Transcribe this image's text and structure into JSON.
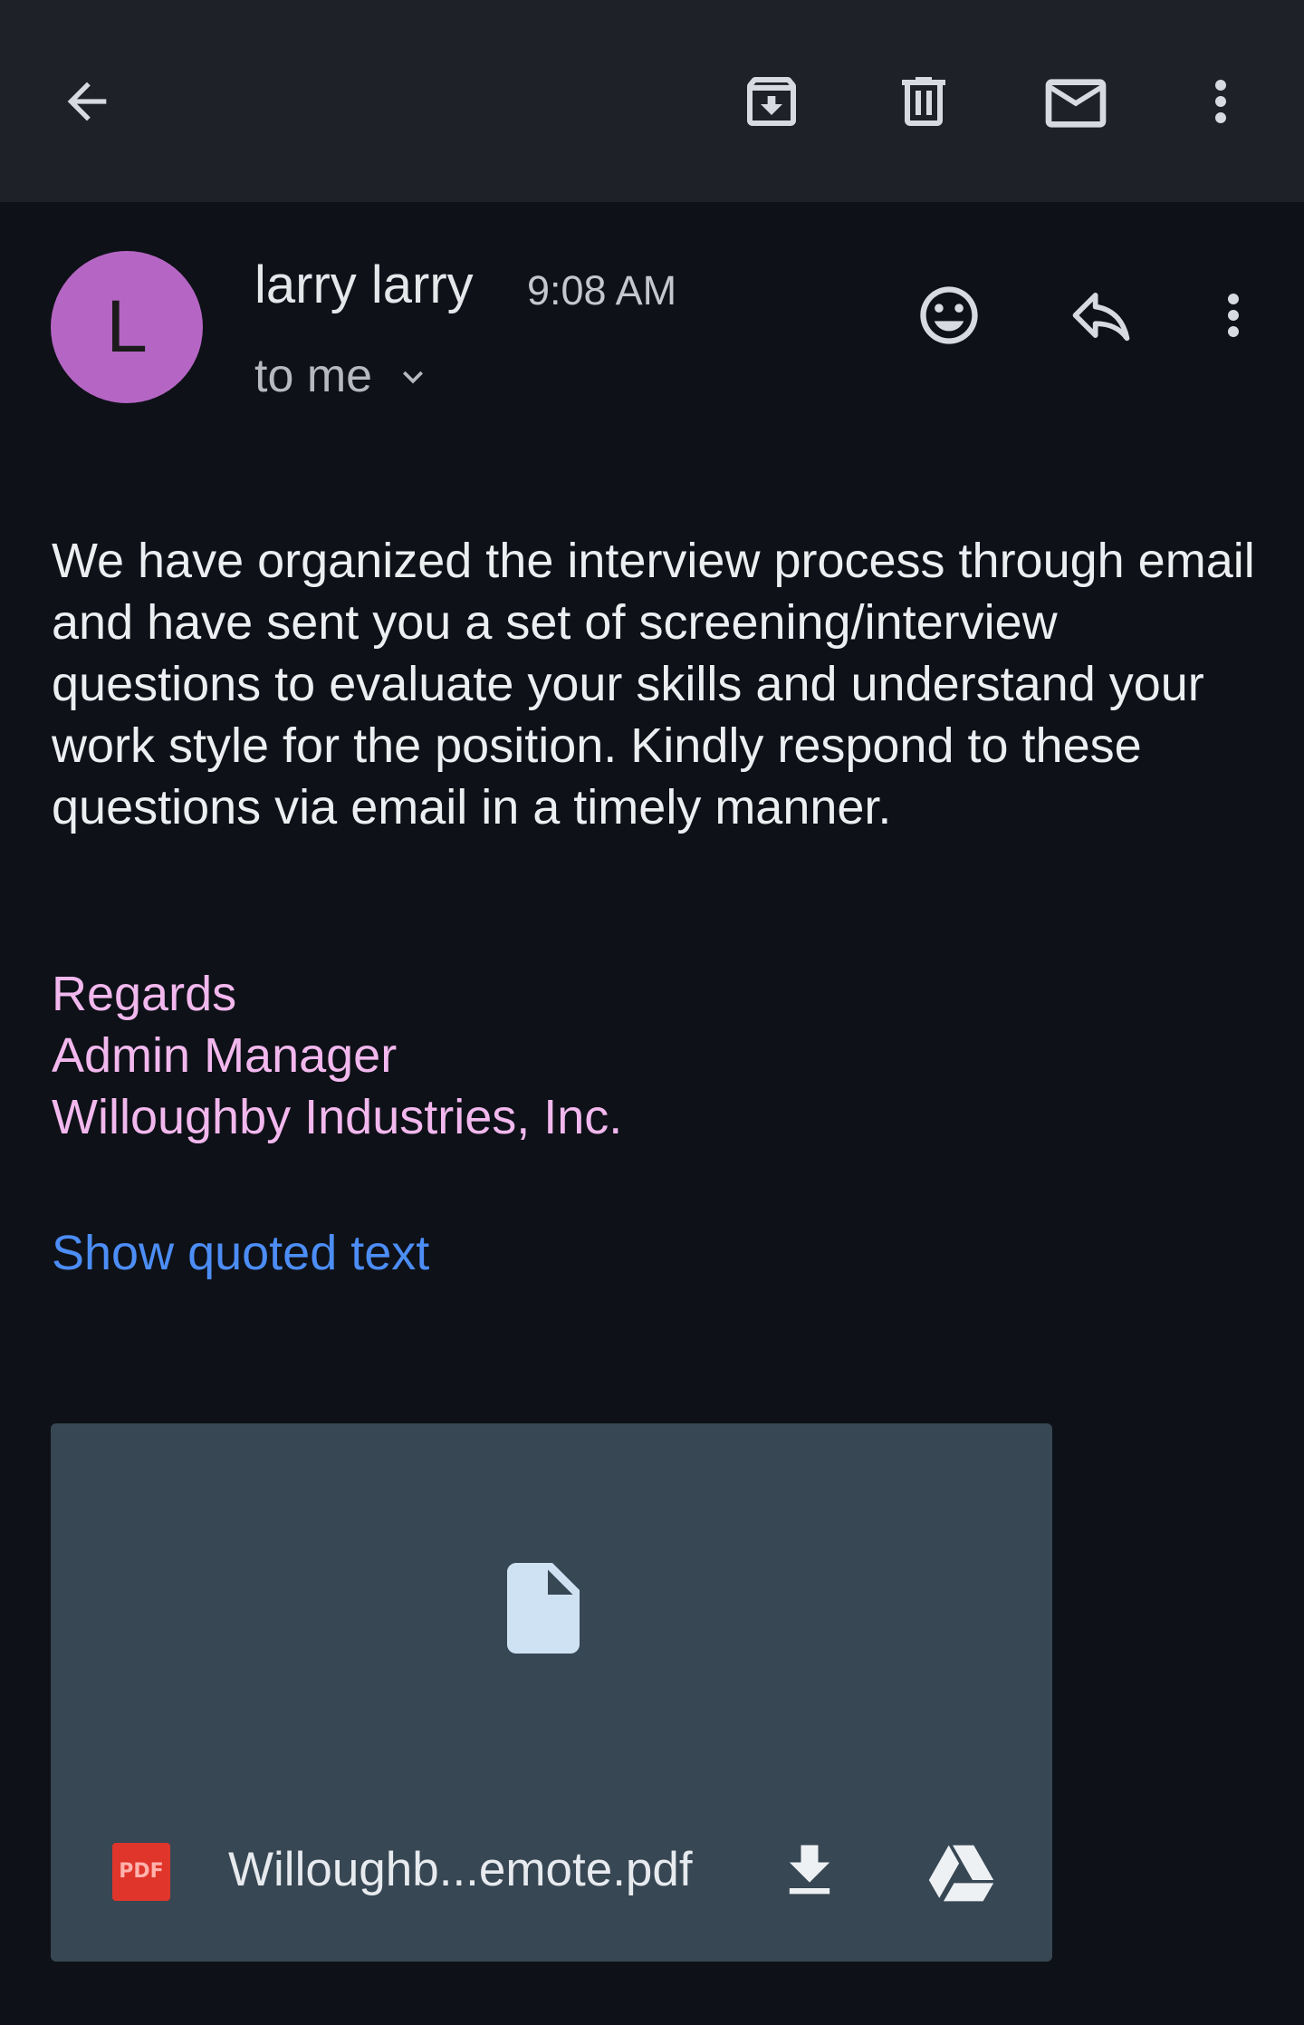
{
  "toolbar": {
    "back_icon": "arrow-left-icon",
    "archive_icon": "archive-icon",
    "delete_icon": "trash-icon",
    "mark_unread_icon": "mail-icon",
    "overflow_icon": "more-vertical-icon"
  },
  "message": {
    "avatar_letter": "L",
    "avatar_color": "#b566c4",
    "sender": "larry larry",
    "time": "9:08 AM",
    "recipient": "to me",
    "body": "We have organized the interview process through email and have sent you a set of screening/interview questions to evaluate your skills and understand your work style for the position. Kindly respond to these questions via email in a timely manner.",
    "signature": [
      "Regards",
      "Admin Manager",
      "Willoughby Industries, Inc."
    ],
    "show_quoted": "Show quoted text"
  },
  "attachment": {
    "type_label": "PDF",
    "filename": "Willoughb...emote.pdf"
  },
  "colors": {
    "appbar": "#1e2128",
    "background": "#0e1117",
    "signature": "#f2b8ee",
    "link": "#4c8df6",
    "attachment_card": "#374753"
  }
}
